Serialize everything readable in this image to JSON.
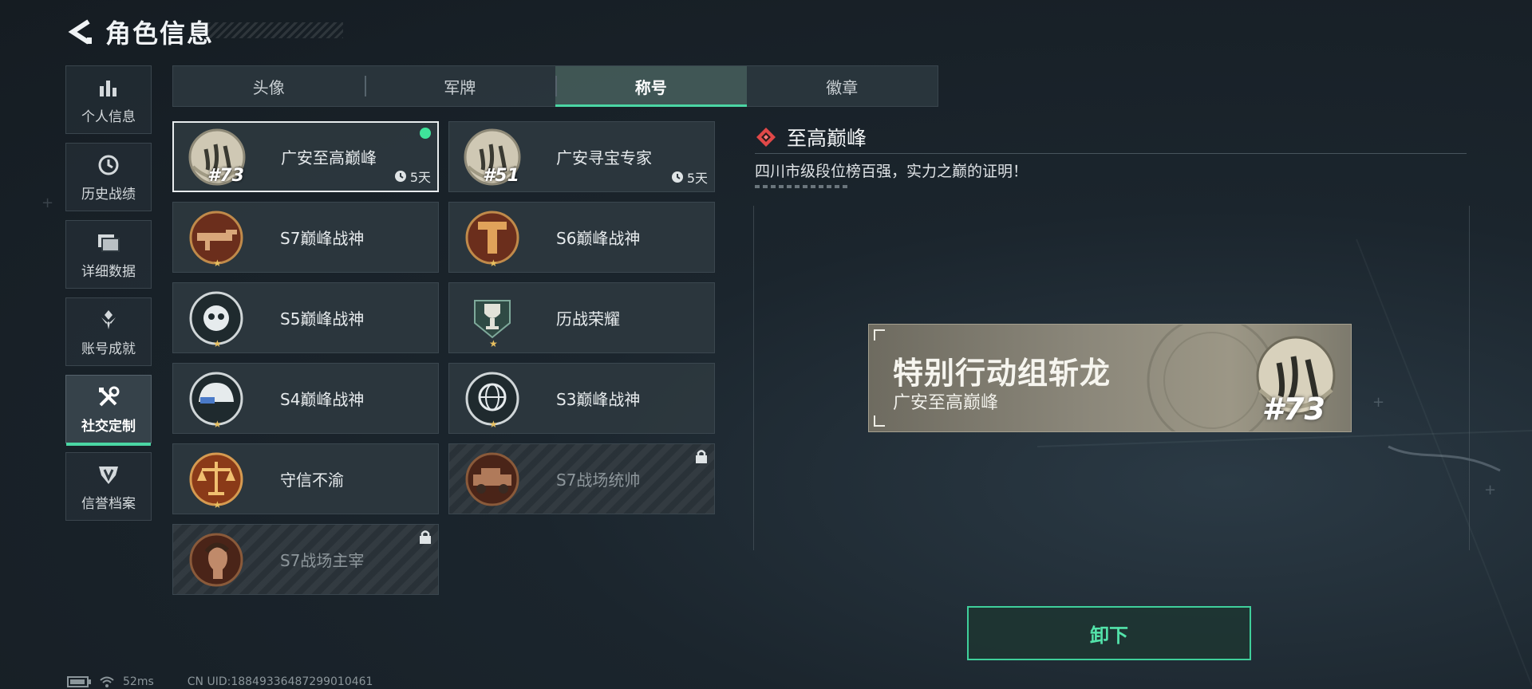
{
  "header": {
    "title": "角色信息",
    "back_icon": "back-arrow-icon"
  },
  "sidenav": [
    {
      "label": "个人信息",
      "icon": "bar-chart-icon",
      "active": false
    },
    {
      "label": "历史战绩",
      "icon": "history-clock-icon",
      "active": false
    },
    {
      "label": "详细数据",
      "icon": "folder-icon",
      "active": false
    },
    {
      "label": "账号成就",
      "icon": "achievement-icon",
      "active": false
    },
    {
      "label": "社交定制",
      "icon": "tools-icon",
      "active": true
    },
    {
      "label": "信誉档案",
      "icon": "credit-shield-icon",
      "active": false
    }
  ],
  "tabs": [
    {
      "label": "头像",
      "active": false
    },
    {
      "label": "军牌",
      "active": false
    },
    {
      "label": "称号",
      "active": true
    },
    {
      "label": "徽章",
      "active": false
    }
  ],
  "titles": [
    {
      "name": "广安至高巅峰",
      "rank": "#73",
      "timer": "5天",
      "selected": true,
      "equipped": true,
      "locked": false,
      "emblem": "sichuan-seal-icon"
    },
    {
      "name": "广安寻宝专家",
      "rank": "#51",
      "timer": "5天",
      "selected": false,
      "equipped": false,
      "locked": false,
      "emblem": "sichuan-seal-icon"
    },
    {
      "name": "S7巅峰战神",
      "selected": false,
      "locked": false,
      "emblem": "rifle-emblem-icon"
    },
    {
      "name": "S6巅峰战神",
      "selected": false,
      "locked": false,
      "emblem": "t-shield-emblem-icon"
    },
    {
      "name": "S5巅峰战神",
      "selected": false,
      "locked": false,
      "emblem": "skull-emblem-icon"
    },
    {
      "name": "历战荣耀",
      "selected": false,
      "locked": false,
      "emblem": "trophy-emblem-icon"
    },
    {
      "name": "S4巅峰战神",
      "selected": false,
      "locked": false,
      "emblem": "helmet-emblem-icon"
    },
    {
      "name": "S3巅峰战神",
      "selected": false,
      "locked": false,
      "emblem": "globe-emblem-icon"
    },
    {
      "name": "守信不渝",
      "selected": false,
      "locked": false,
      "emblem": "scales-emblem-icon"
    },
    {
      "name": "S7战场统帅",
      "selected": false,
      "locked": true,
      "emblem": "vehicle-emblem-icon"
    },
    {
      "name": "S7战场主宰",
      "selected": false,
      "locked": true,
      "emblem": "portrait-emblem-icon"
    }
  ],
  "detail": {
    "title": "至高巅峰",
    "description": "四川市级段位榜百强，实力之巅的证明！",
    "nameplate": {
      "player_name": "特别行动组斩龙",
      "title": "广安至高巅峰",
      "rank": "#73"
    },
    "unequip_label": "卸下"
  },
  "status": {
    "ping": "52ms",
    "uid": "CN UID:1884933648729901046​1"
  },
  "colors": {
    "accent": "#4bd6a4",
    "equipped_dot": "#3fe39a",
    "card_bg": "#2e383f",
    "background": "#1b252d"
  }
}
